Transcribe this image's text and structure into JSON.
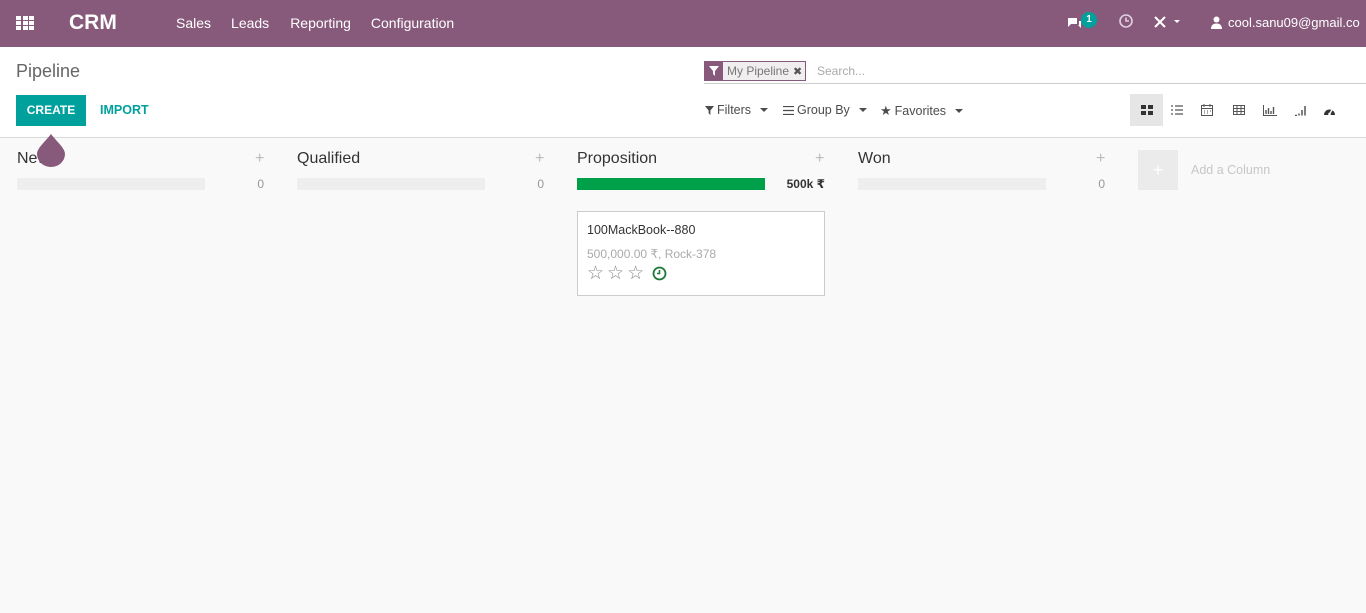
{
  "topbar": {
    "app_name": "CRM",
    "menu": [
      "Sales",
      "Leads",
      "Reporting",
      "Configuration"
    ],
    "messages_count": "1",
    "user": "cool.sanu09@gmail.co"
  },
  "control": {
    "breadcrumb": "Pipeline",
    "create_label": "CREATE",
    "import_label": "IMPORT",
    "facet": "My Pipeline",
    "facet_remove": "✖",
    "search_placeholder": "Search...",
    "filters": "Filters",
    "group_by": "Group By",
    "favorites": "Favorites"
  },
  "views": [
    "kanban",
    "list",
    "calendar",
    "pivot",
    "graph",
    "cohort",
    "dashboard"
  ],
  "kanban": {
    "columns": [
      {
        "title": "New",
        "count": "0",
        "progress": 0
      },
      {
        "title": "Qualified",
        "count": "0",
        "progress": 0
      },
      {
        "title": "Proposition",
        "count": "500k ₹",
        "progress": 1.0
      },
      {
        "title": "Won",
        "count": "0",
        "progress": 0
      }
    ],
    "card": {
      "title": "100MackBook--880",
      "subtitle": "500,000.00 ₹, Rock-378",
      "stars": 0
    },
    "add_column": "Add a Column",
    "add_column_plus": "+"
  },
  "colors": {
    "brand": "#875a7b",
    "accent": "#00a09d",
    "progress_green": "#00a04a"
  }
}
